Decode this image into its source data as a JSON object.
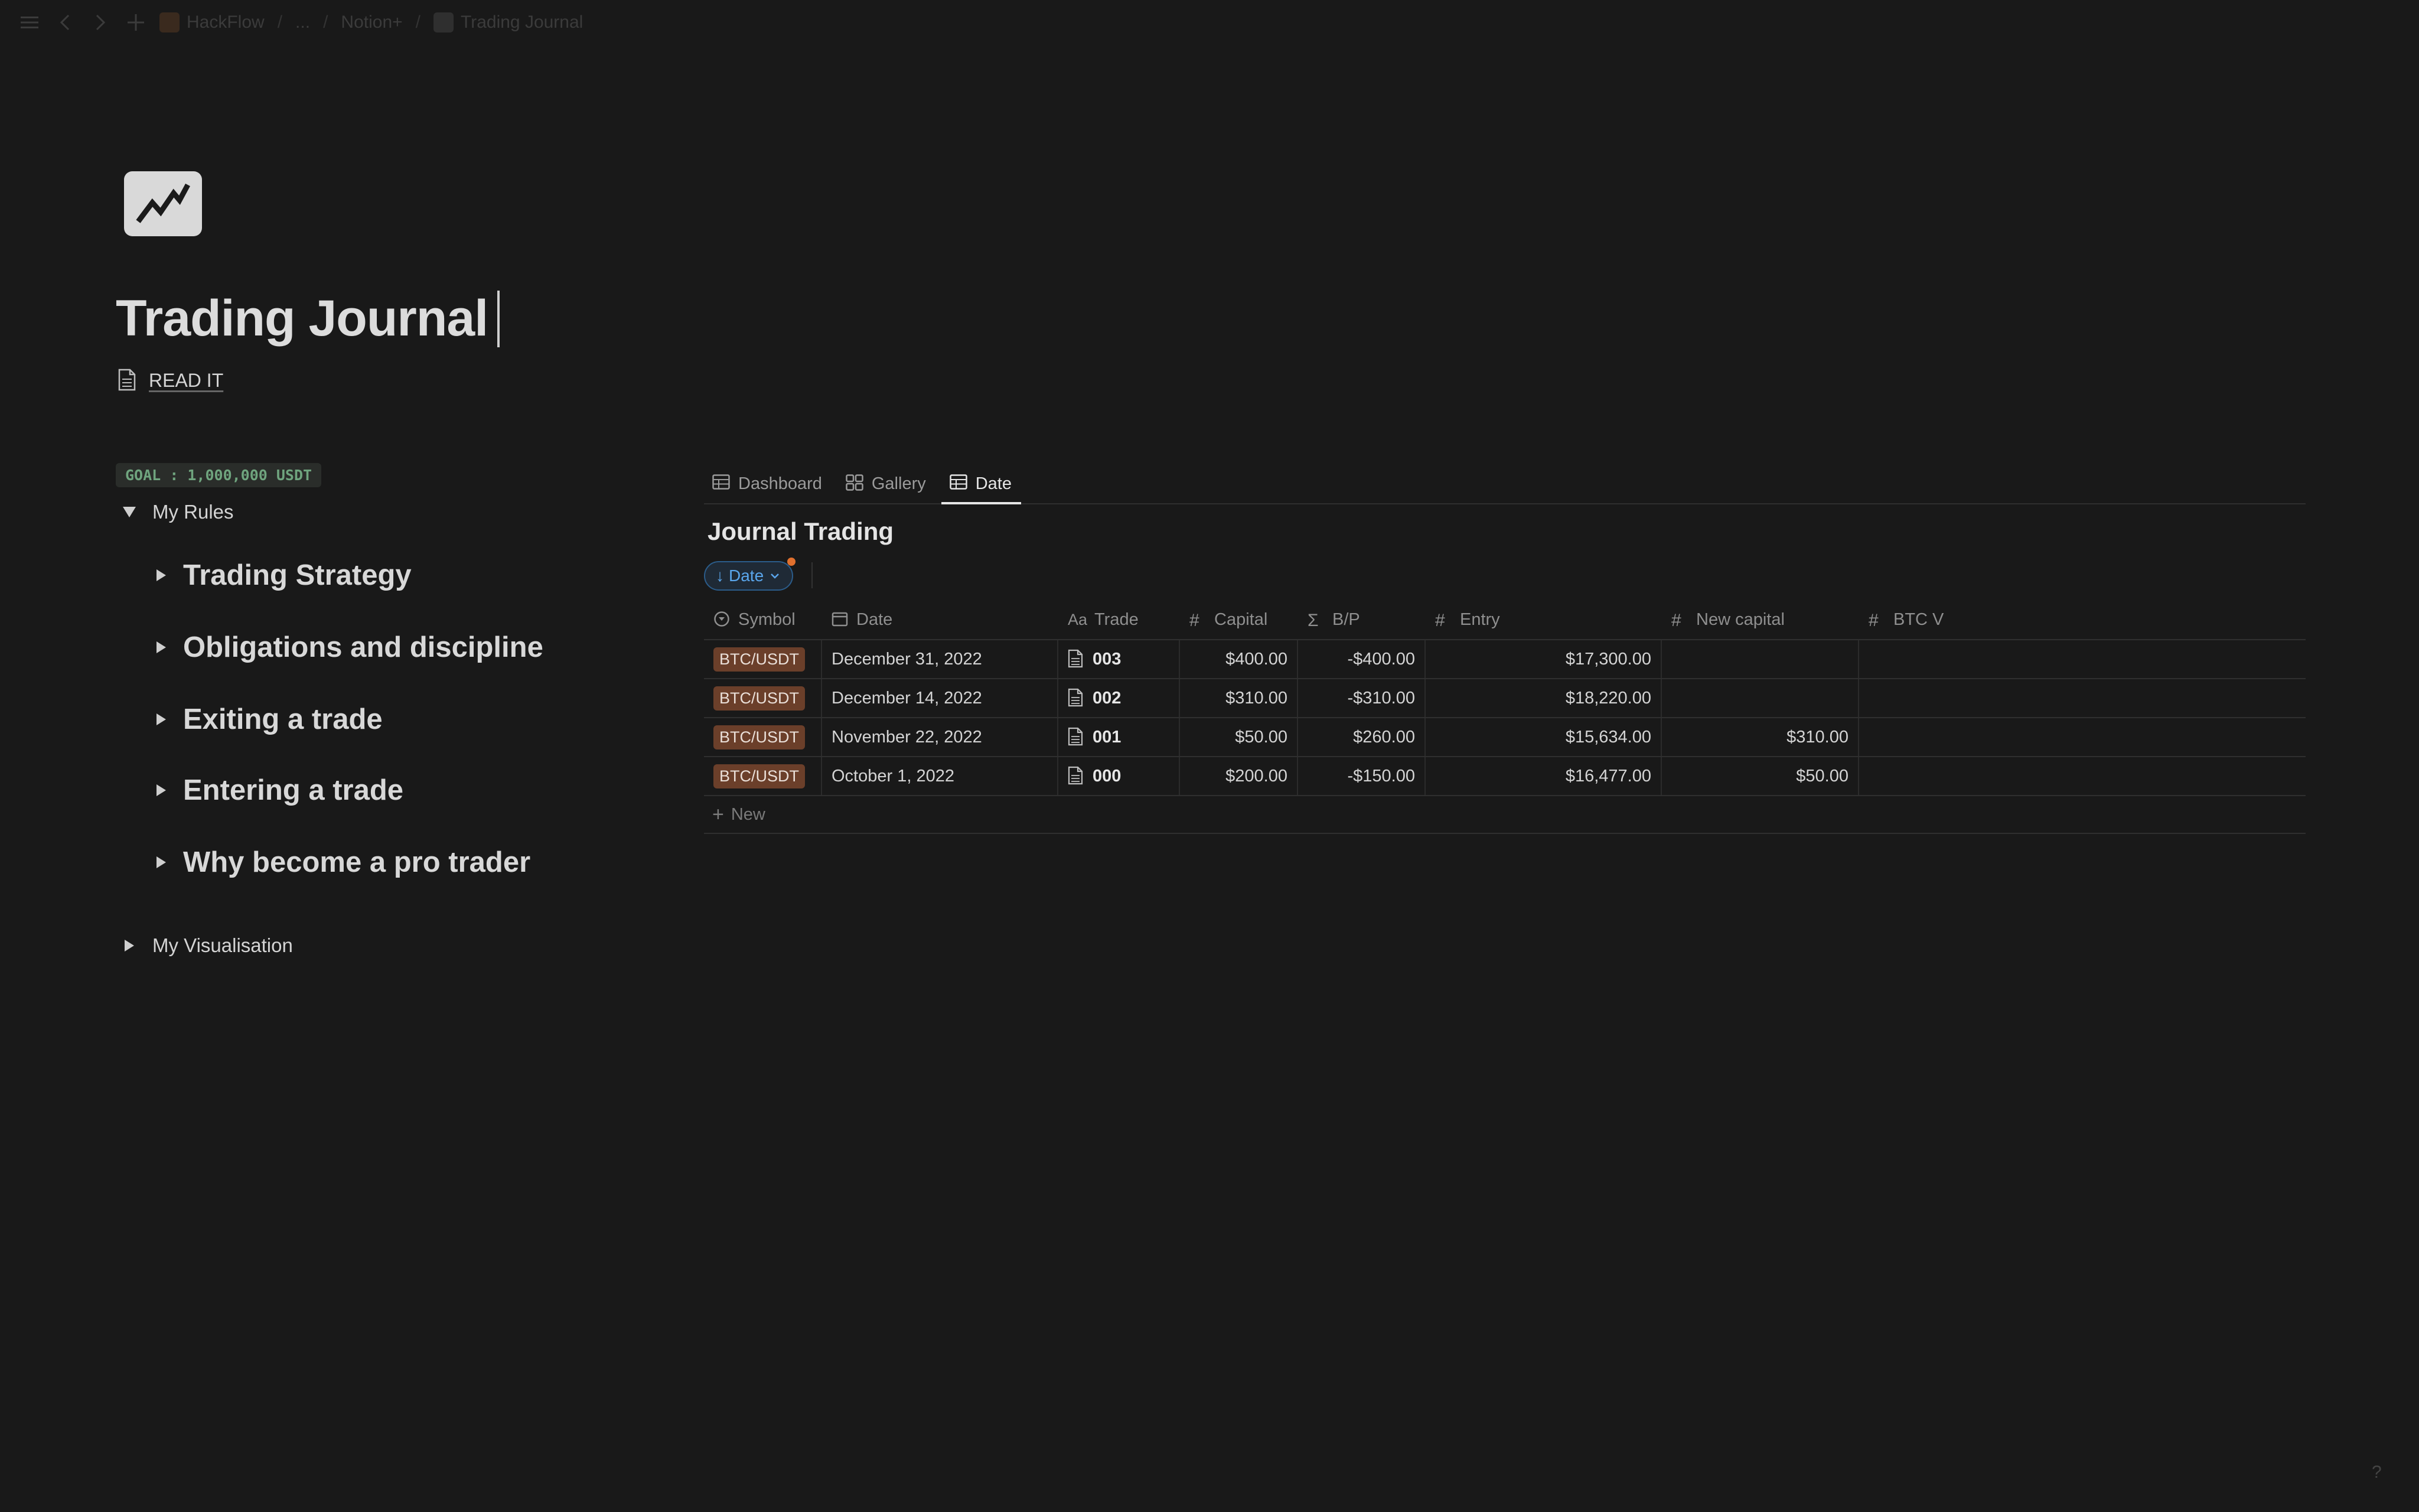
{
  "topbar": {
    "workspace": "HackFlow",
    "ellipsis": "...",
    "parent": "Notion+",
    "current": "Trading Journal"
  },
  "page": {
    "title": "Trading Journal",
    "read_it": "READ IT",
    "goal": "GOAL : 1,000,000 USDT"
  },
  "rules": {
    "label": "My Rules",
    "items": [
      "Trading Strategy",
      "Obligations and discipline",
      "Exiting a trade",
      "Entering a trade",
      "Why become a pro trader"
    ],
    "visualisation": "My Visualisation"
  },
  "database": {
    "tabs": [
      "Dashboard",
      "Gallery",
      "Date"
    ],
    "active_tab": "Date",
    "title": "Journal Trading",
    "sort_label": "Date",
    "columns": [
      "Symbol",
      "Date",
      "Trade",
      "Capital",
      "B/P",
      "Entry",
      "New capital",
      "BTC V"
    ],
    "rows": [
      {
        "symbol": "BTC/USDT",
        "date": "December 31, 2022",
        "trade": "003",
        "capital": "$400.00",
        "bp": "-$400.00",
        "entry": "$17,300.00",
        "new_capital": "",
        "btc_v": ""
      },
      {
        "symbol": "BTC/USDT",
        "date": "December 14, 2022",
        "trade": "002",
        "capital": "$310.00",
        "bp": "-$310.00",
        "entry": "$18,220.00",
        "new_capital": "",
        "btc_v": ""
      },
      {
        "symbol": "BTC/USDT",
        "date": "November 22, 2022",
        "trade": "001",
        "capital": "$50.00",
        "bp": "$260.00",
        "entry": "$15,634.00",
        "new_capital": "$310.00",
        "btc_v": ""
      },
      {
        "symbol": "BTC/USDT",
        "date": "October 1, 2022",
        "trade": "000",
        "capital": "$200.00",
        "bp": "-$150.00",
        "entry": "$16,477.00",
        "new_capital": "$50.00",
        "btc_v": ""
      }
    ],
    "new_label": "New"
  },
  "colors": {
    "background": "#191919",
    "accent_blue": "#5aa6ec",
    "tag_brown": "#6b3f2a",
    "goal_green": "#6fa47e"
  },
  "help": "?"
}
